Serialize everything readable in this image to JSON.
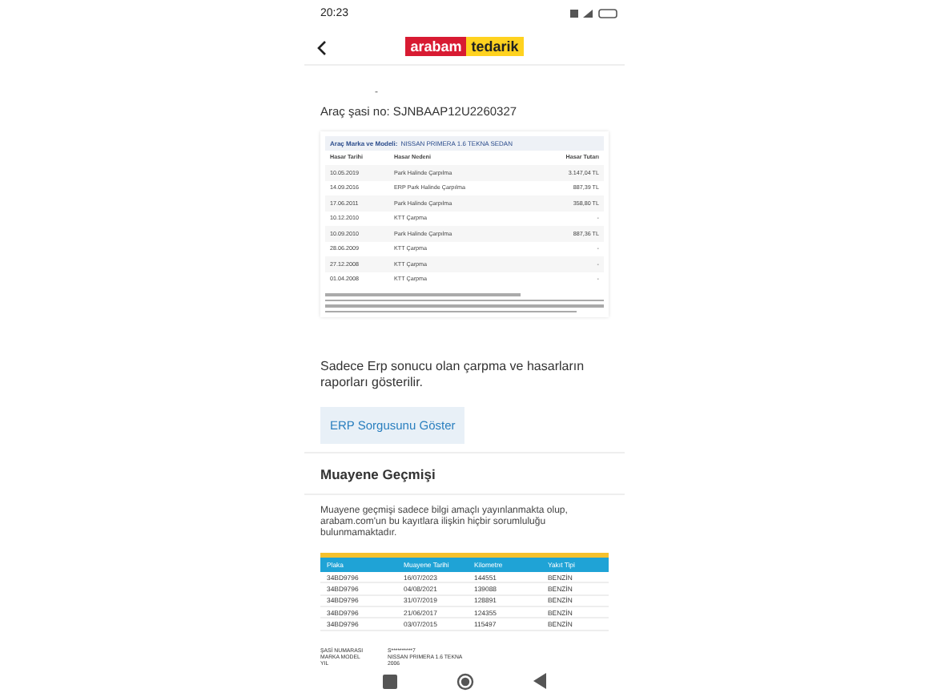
{
  "status_bar": {
    "time": "20:23"
  },
  "header": {
    "logo_left": "arabam",
    "logo_right": "tedarik"
  },
  "dash": "-",
  "chassis": "Araç şasi no: SJNBAAP12U2260327",
  "damage_report": {
    "brand_label": "Araç Marka ve Modeli:",
    "brand_value": "NISSAN PRIMERA 1.6 TEKNA SEDAN",
    "columns": [
      "Hasar Tarihi",
      "Hasar Nedeni",
      "Hasar Tutarı"
    ],
    "rows": [
      [
        "10.05.2019",
        "Park Halinde Çarpılma",
        "3.147,04 TL"
      ],
      [
        "14.09.2016",
        "ERP Park Halinde Çarpılma",
        "887,39 TL"
      ],
      [
        "17.06.2011",
        "Park Halinde Çarpılma",
        "358,80 TL"
      ],
      [
        "10.12.2010",
        "KTT Çarpma",
        "-"
      ],
      [
        "10.09.2010",
        "Park Halinde Çarpılma",
        "887,36 TL"
      ],
      [
        "28.06.2009",
        "KTT Çarpma",
        "-"
      ],
      [
        "27.12.2008",
        "KTT Çarpma",
        "-"
      ],
      [
        "01.04.2008",
        "KTT Çarpma",
        "-"
      ]
    ]
  },
  "erp_note": "Sadece Erp sonucu olan çarpma ve hasarların raporları gösterilir.",
  "erp_button": "ERP Sorgusunu Göster",
  "inspection": {
    "title": "Muayene Geçmişi",
    "note": "Muayene geçmişi sadece bilgi amaçlı yayınlanmakta olup, arabam.com'un bu kayıtlara ilişkin hiçbir sorumluluğu bulunmamaktadır.",
    "columns": [
      "Plaka",
      "Muayene Tarihi",
      "Kilometre",
      "Yakıt Tipi"
    ],
    "rows": [
      [
        "34BD9796",
        "16/07/2023",
        "144551",
        "BENZİN"
      ],
      [
        "34BD9796",
        "04/08/2021",
        "139088",
        "BENZİN"
      ],
      [
        "34BD9796",
        "31/07/2019",
        "128891",
        "BENZİN"
      ],
      [
        "34BD9796",
        "21/06/2017",
        "124355",
        "BENZİN"
      ],
      [
        "34BD9796",
        "03/07/2015",
        "115497",
        "BENZİN"
      ]
    ],
    "details": [
      [
        "ŞASİ NUMARASI",
        "S**********7"
      ],
      [
        "MARKA MODEL",
        "NISSAN PRIMERA 1.6 TEKNA"
      ],
      [
        "YIL",
        "2006"
      ]
    ]
  }
}
